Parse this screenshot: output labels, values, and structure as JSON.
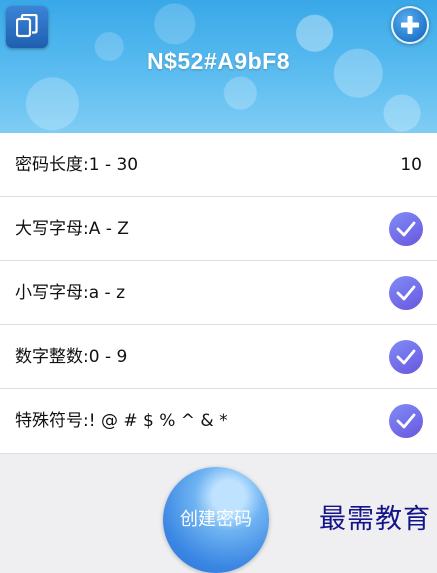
{
  "header": {
    "password": "N$52#A9bF8",
    "copy_icon": "copy-icon",
    "add_icon": "plus-icon"
  },
  "options": [
    {
      "label": "密码长度:1 - 30",
      "value": "10"
    },
    {
      "label": "大写字母:A - Z",
      "checked": true
    },
    {
      "label": "小写字母:a - z",
      "checked": true
    },
    {
      "label": "数字整数:0 - 9",
      "checked": true
    },
    {
      "label": "特殊符号:! @ # $ % ^ & *",
      "checked": true
    }
  ],
  "create_button": {
    "label": "创建密码"
  },
  "watermark": "最需教育",
  "colors": {
    "header_blue": "#39a8e8",
    "check_purple": "#7f8cf5",
    "button_blue": "#3a86e3",
    "watermark": "#14148a"
  }
}
